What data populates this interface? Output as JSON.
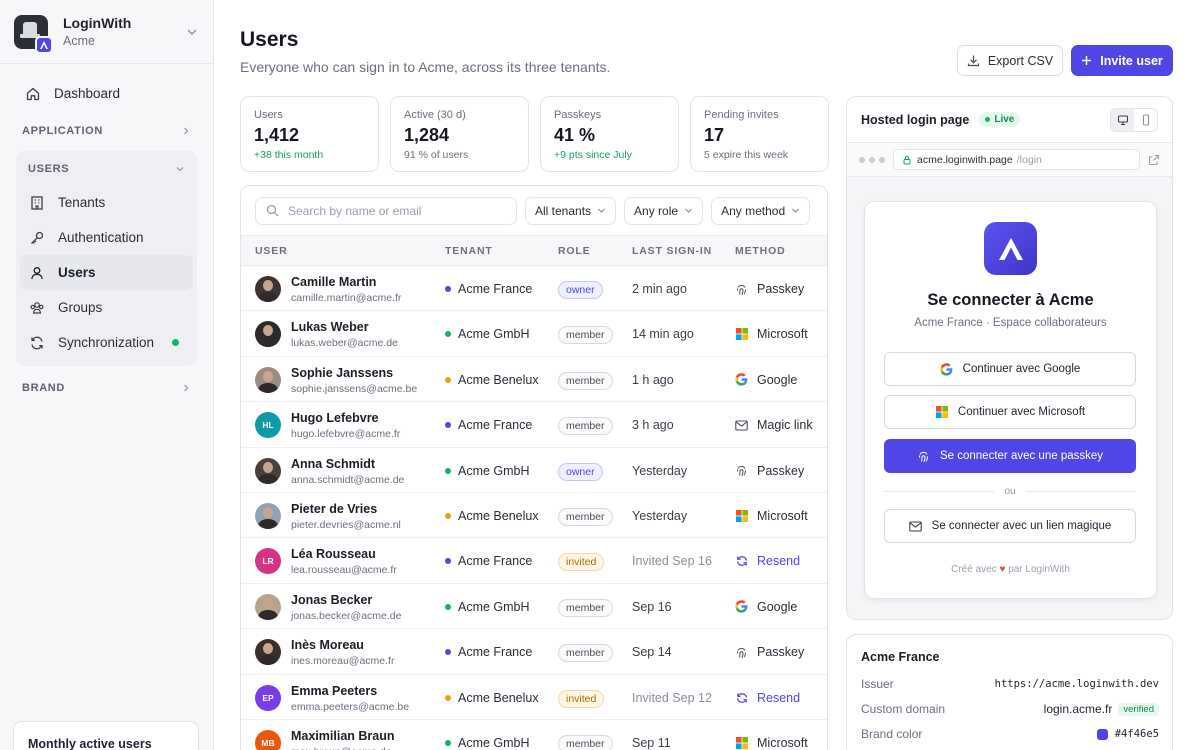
{
  "org": {
    "name": "LoginWith",
    "sub": "Acme"
  },
  "nav": {
    "dashboard": "Dashboard",
    "application": "APPLICATION",
    "users_section": "USERS",
    "tenants": "Tenants",
    "authentication": "Authentication",
    "users": "Users",
    "groups": "Groups",
    "synchronization": "Synchronization",
    "brand": "BRAND"
  },
  "mau_title": "Monthly active users",
  "page": {
    "title": "Users",
    "subtitle": "Everyone who can sign in to Acme, across its three tenants.",
    "export_label": "Export CSV",
    "invite_label": "Invite user"
  },
  "stats": [
    {
      "label": "Users",
      "value": "1,412",
      "delta": "+38 this month",
      "positive": true
    },
    {
      "label": "Active (30 d)",
      "value": "1,284",
      "delta": "91 % of users",
      "positive": false
    },
    {
      "label": "Passkeys",
      "value": "41 %",
      "delta": "+9 pts since July",
      "positive": true
    },
    {
      "label": "Pending invites",
      "value": "17",
      "delta": "5 expire this week",
      "positive": false
    }
  ],
  "filters": {
    "search_placeholder": "Search by name or email",
    "tenant": "All tenants",
    "role": "Any role",
    "method": "Any method"
  },
  "columns": {
    "user": "USER",
    "tenant": "TENANT",
    "role": "ROLE",
    "last_signin": "LAST SIGN-IN",
    "method": "METHOD"
  },
  "tenant_colors": {
    "Acme France": "#4f46e5",
    "Acme GmbH": "#16b364",
    "Acme Benelux": "#f59e0b"
  },
  "users": [
    {
      "name": "Camille Martin",
      "email": "camille.martin@acme.fr",
      "tenant": "Acme France",
      "role": "owner",
      "last": "2 min ago",
      "method": "Passkey",
      "method_icon": "passkey",
      "avatar": "photo",
      "initials": "",
      "avatar_color": "#3b3431"
    },
    {
      "name": "Lukas Weber",
      "email": "lukas.weber@acme.de",
      "tenant": "Acme GmbH",
      "role": "member",
      "last": "14 min ago",
      "method": "Microsoft",
      "method_icon": "microsoft",
      "avatar": "photo",
      "initials": "",
      "avatar_color": "#2d2a29"
    },
    {
      "name": "Sophie Janssens",
      "email": "sophie.janssens@acme.be",
      "tenant": "Acme Benelux",
      "role": "member",
      "last": "1 h ago",
      "method": "Google",
      "method_icon": "google",
      "avatar": "photo",
      "initials": "",
      "avatar_color": "#9c8b80"
    },
    {
      "name": "Hugo Lefebvre",
      "email": "hugo.lefebvre@acme.fr",
      "tenant": "Acme France",
      "role": "member",
      "last": "3 h ago",
      "method": "Magic link",
      "method_icon": "mail",
      "avatar": "initials",
      "initials": "HL",
      "avatar_color": "#0e9aa7"
    },
    {
      "name": "Anna Schmidt",
      "email": "anna.schmidt@acme.de",
      "tenant": "Acme GmbH",
      "role": "owner",
      "last": "Yesterday",
      "method": "Passkey",
      "method_icon": "passkey",
      "avatar": "photo",
      "initials": "",
      "avatar_color": "#4a403c"
    },
    {
      "name": "Pieter de Vries",
      "email": "pieter.devries@acme.nl",
      "tenant": "Acme Benelux",
      "role": "member",
      "last": "Yesterday",
      "method": "Microsoft",
      "method_icon": "microsoft",
      "avatar": "photo",
      "initials": "",
      "avatar_color": "#8fa3b5"
    },
    {
      "name": "Léa Rousseau",
      "email": "lea.rousseau@acme.fr",
      "tenant": "Acme France",
      "role": "invited",
      "last": "Invited Sep 16",
      "method": "Resend",
      "method_icon": "resend",
      "avatar": "initials",
      "initials": "LR",
      "avatar_color": "#d63384"
    },
    {
      "name": "Jonas Becker",
      "email": "jonas.becker@acme.de",
      "tenant": "Acme GmbH",
      "role": "member",
      "last": "Sep 16",
      "method": "Google",
      "method_icon": "google",
      "avatar": "photo",
      "initials": "",
      "avatar_color": "#b5a58a"
    },
    {
      "name": "Inès Moreau",
      "email": "ines.moreau@acme.fr",
      "tenant": "Acme France",
      "role": "member",
      "last": "Sep 14",
      "method": "Passkey",
      "method_icon": "passkey",
      "avatar": "photo",
      "initials": "",
      "avatar_color": "#3b2e2a"
    },
    {
      "name": "Emma Peeters",
      "email": "emma.peeters@acme.be",
      "tenant": "Acme Benelux",
      "role": "invited",
      "last": "Invited Sep 12",
      "method": "Resend",
      "method_icon": "resend",
      "avatar": "initials",
      "initials": "EP",
      "avatar_color": "#7c3aed"
    },
    {
      "name": "Maximilian Braun",
      "email": "max.braun@acme.de",
      "tenant": "Acme GmbH",
      "role": "member",
      "last": "Sep 11",
      "method": "Microsoft",
      "method_icon": "microsoft",
      "avatar": "initials",
      "initials": "MB",
      "avatar_color": "#ea580c"
    }
  ],
  "hosted": {
    "title": "Hosted login page",
    "live": "Live",
    "url_host": "acme.loginwith.page",
    "url_path": "/login",
    "login_title": "Se connecter à Acme",
    "login_sub": "Acme France · Espace collaborateurs",
    "google_btn": "Continuer avec Google",
    "microsoft_btn": "Continuer avec Microsoft",
    "passkey_btn": "Se connecter avec une passkey",
    "or": "ou",
    "magic_btn": "Se connecter avec un lien magique",
    "made_prefix": "Créé avec",
    "made_suffix": "par LoginWith"
  },
  "tenant_card": {
    "title": "Acme France",
    "issuer_label": "Issuer",
    "issuer_value": "https://acme.loginwith.dev",
    "domain_label": "Custom domain",
    "domain_value": "login.acme.fr",
    "verified": "verified",
    "brand_label": "Brand color",
    "brand_value": "#4f46e5"
  },
  "colors": {
    "accent": "#4f46e5",
    "success": "#16b364"
  }
}
